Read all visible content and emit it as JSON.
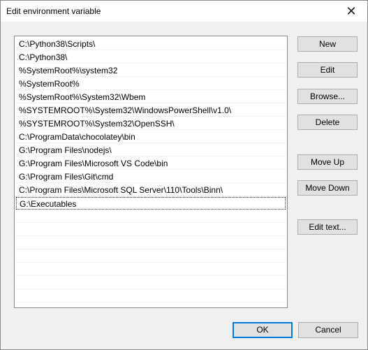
{
  "window": {
    "title": "Edit environment variable",
    "close_glyph": "✕"
  },
  "list": {
    "items": [
      "C:\\Python38\\Scripts\\",
      "C:\\Python38\\",
      "%SystemRoot%\\system32",
      "%SystemRoot%",
      "%SystemRoot%\\System32\\Wbem",
      "%SYSTEMROOT%\\System32\\WindowsPowerShell\\v1.0\\",
      "%SYSTEMROOT%\\System32\\OpenSSH\\",
      "C:\\ProgramData\\chocolatey\\bin",
      "G:\\Program Files\\nodejs\\",
      "G:\\Program Files\\Microsoft VS Code\\bin",
      "G:\\Program Files\\Git\\cmd",
      "C:\\Program Files\\Microsoft SQL Server\\110\\Tools\\Binn\\",
      "G:\\Executables"
    ],
    "selected_index": 12
  },
  "buttons": {
    "new": "New",
    "edit": "Edit",
    "browse": "Browse...",
    "delete": "Delete",
    "move_up": "Move Up",
    "move_down": "Move Down",
    "edit_text": "Edit text..."
  },
  "footer": {
    "ok": "OK",
    "cancel": "Cancel"
  }
}
